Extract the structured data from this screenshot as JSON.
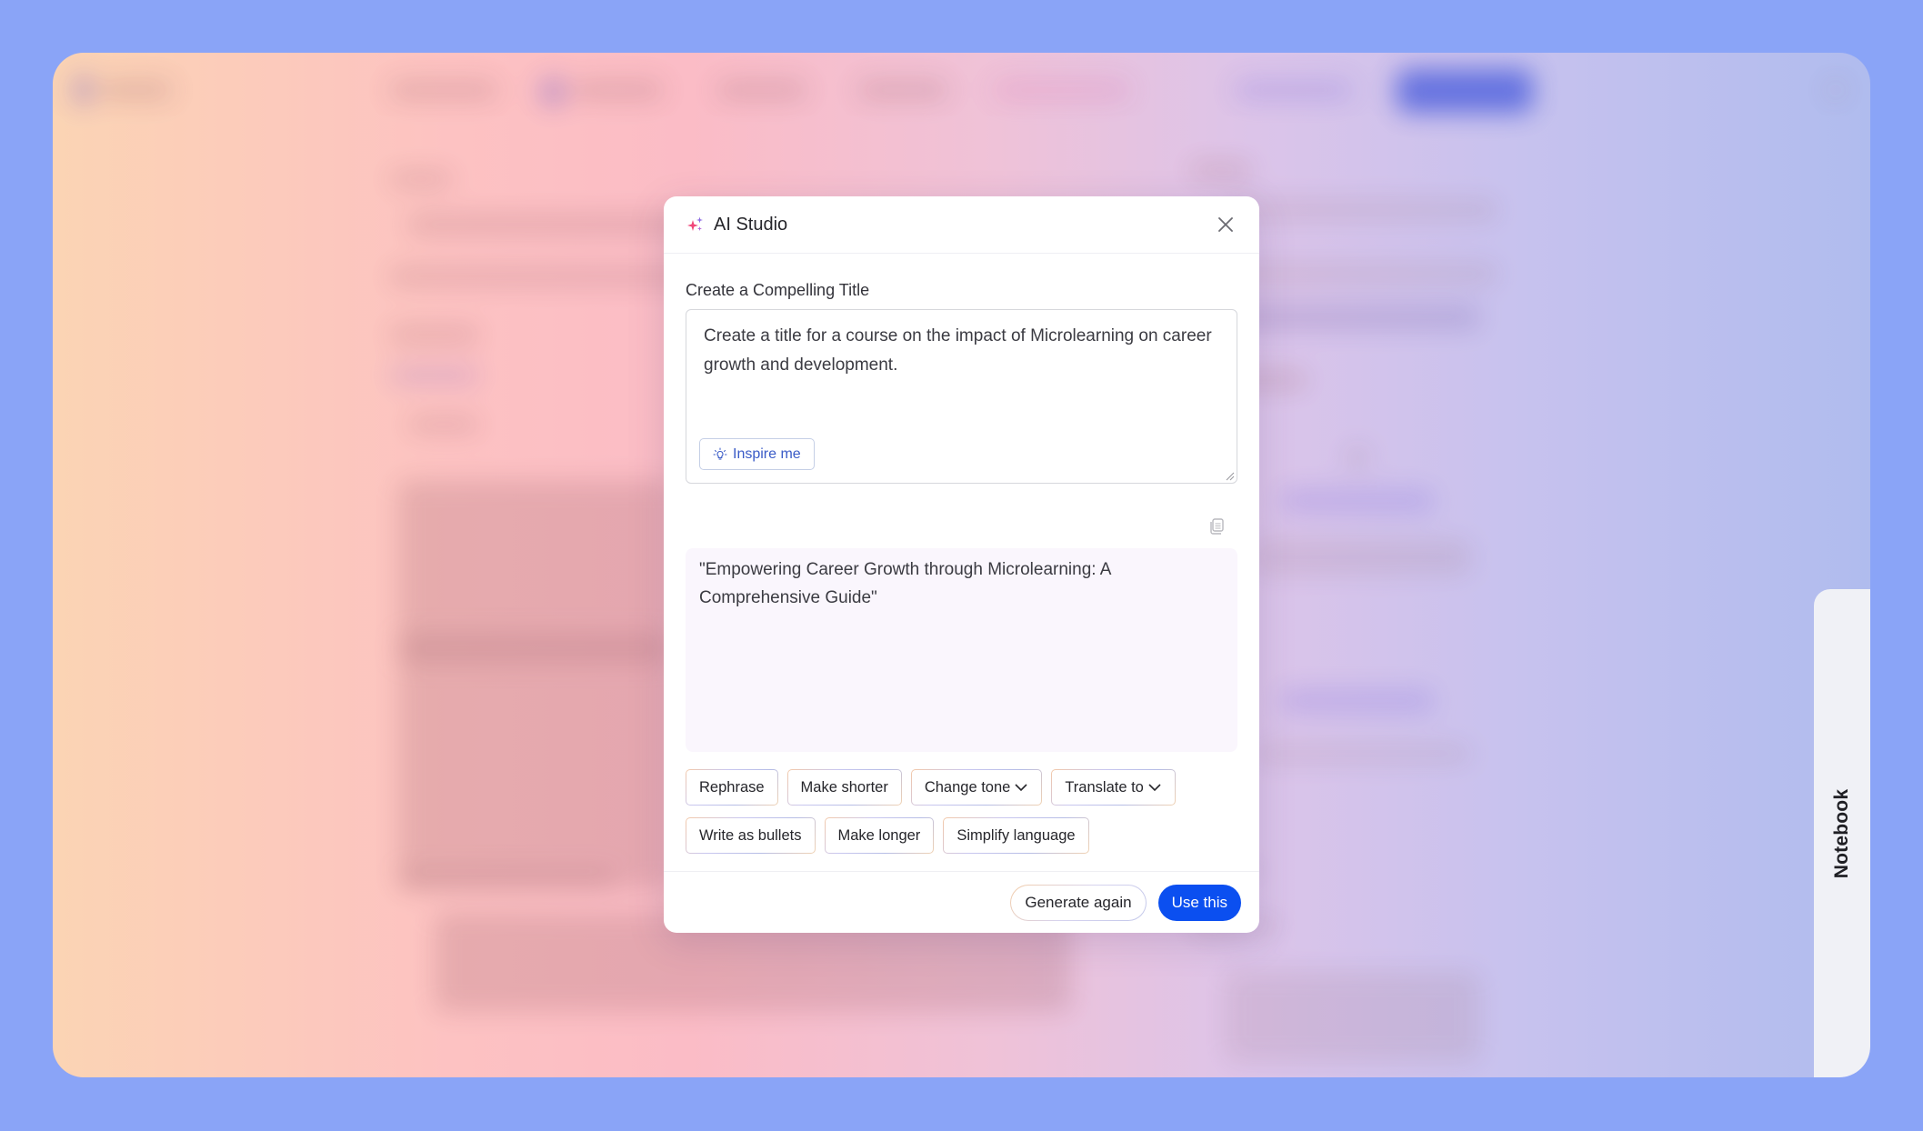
{
  "background": {
    "description": "blurred application content behind modal (not legible)"
  },
  "side_tab": {
    "label": "Notebook"
  },
  "modal": {
    "title": "AI Studio",
    "icons": {
      "title_icon": "sparkle-icon",
      "close": "close-icon",
      "inspire": "lightbulb-icon",
      "copy": "copy-icon",
      "dropdown": "chevron-down-icon"
    },
    "prompt": {
      "label": "Create a Compelling Title",
      "value": "Create a title for a course on the impact of Microlearning on career growth and development.",
      "inspire_label": "Inspire me"
    },
    "result": {
      "text": "\"Empowering Career Growth through Microlearning: A Comprehensive Guide\""
    },
    "actions": [
      {
        "label": "Rephrase",
        "dropdown": false
      },
      {
        "label": "Make shorter",
        "dropdown": false
      },
      {
        "label": "Change tone",
        "dropdown": true
      },
      {
        "label": "Translate to",
        "dropdown": true
      },
      {
        "label": "Write as bullets",
        "dropdown": false
      },
      {
        "label": "Make longer",
        "dropdown": false
      },
      {
        "label": "Simplify language",
        "dropdown": false
      }
    ],
    "footer": {
      "generate_again_label": "Generate again",
      "use_this_label": "Use this"
    }
  },
  "colors": {
    "primary": "#0b4ff0",
    "inspire_text": "#3a5bc7",
    "result_bg": "#faf6fd",
    "page_bg": "#8aa4f7",
    "sparkle_pink": "#f0477a",
    "sparkle_purple": "#9a6ae0"
  }
}
